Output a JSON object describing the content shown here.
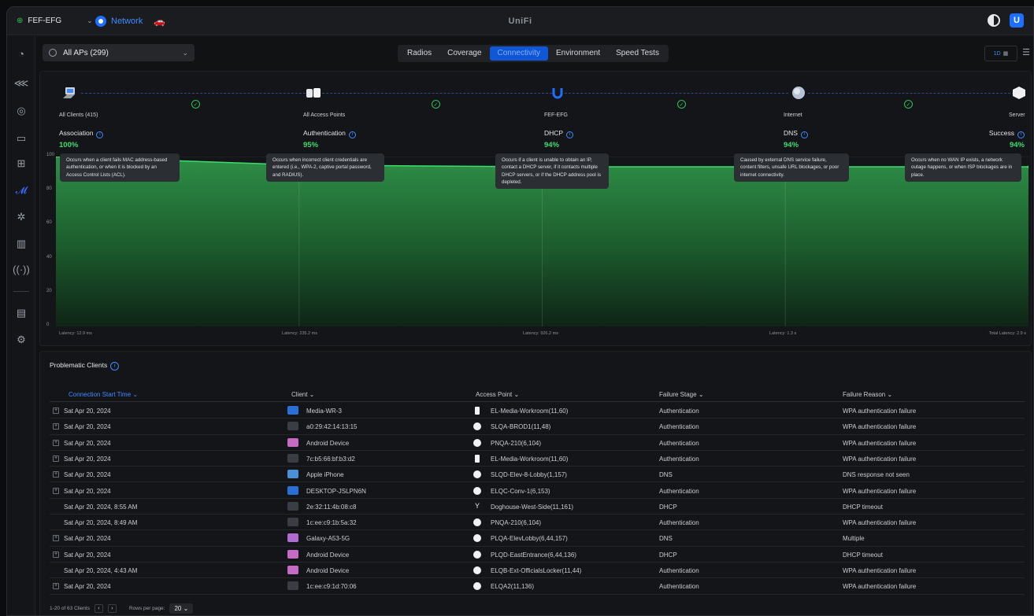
{
  "window": {
    "app_brand": "UniFi",
    "site": "FEF-EFG",
    "network_label": "Network",
    "user_initial": "U"
  },
  "toolbar": {
    "ap_filter": "All APs (299)",
    "tabs": [
      "Radios",
      "Coverage",
      "Connectivity",
      "Environment",
      "Speed Tests"
    ],
    "active_tab": "Connectivity",
    "range": "1D"
  },
  "flow": {
    "nodes": [
      "All Clients (415)",
      "All Access Points",
      "FEF-EFG",
      "Internet",
      "Server"
    ],
    "stats": [
      {
        "label": "Association",
        "value": "100%"
      },
      {
        "label": "Authentication",
        "value": "95%"
      },
      {
        "label": "DHCP",
        "value": "94%"
      },
      {
        "label": "DNS",
        "value": "94%"
      },
      {
        "label": "Success",
        "value": "94%"
      }
    ],
    "tooltips": [
      "Occurs when a client fails MAC address-based authentication, or when it is blocked by an Access Control Lists (ACL).",
      "Occurs when incorrect client credentials are entered (i.e., WPA-2, captive portal password, and RADIUS).",
      "Occurs if a client is unable to obtain an IP, contact a DHCP server, if it contacts multiple DHCP servers, or if the DHCP address pool is depleted.",
      "Caused by external DNS service failure, content filters, unsafe URL blockages, or poor internet connectivity.",
      "Occurs when no WAN IP exists, a network outage happens, or when ISP blockages are in place."
    ],
    "latencies": [
      "Latency: 12.9 ms",
      "Latency: 235.2 ms",
      "Latency: 926.2 ms",
      "Latency: 1.3 s",
      "Total Latency: 2.9 s"
    ]
  },
  "chart_data": {
    "type": "area",
    "x": [
      "Association",
      "Authentication",
      "DHCP",
      "DNS",
      "Success"
    ],
    "series": [
      {
        "values": [
          100,
          95,
          94,
          94,
          94
        ]
      }
    ],
    "ylim": [
      0,
      100
    ],
    "yticks": [
      "100",
      "80",
      "60",
      "40",
      "20",
      "0"
    ],
    "grid": true
  },
  "problematic": {
    "title": "Problematic Clients",
    "columns": [
      "Connection Start Time",
      "Client",
      "Access Point",
      "Failure Stage",
      "Failure Reason"
    ],
    "rows": [
      {
        "expand": true,
        "time": "Sat Apr 20, 2024",
        "client": "Media-WR-3",
        "ap": "EL-Media-Workroom(11,60)",
        "stage": "Authentication",
        "reason": "WPA authentication failure",
        "dev": "#2a6fd6",
        "apshape": "rect"
      },
      {
        "expand": true,
        "time": "Sat Apr 20, 2024",
        "client": "a0:29:42:14:13:15",
        "ap": "SLQA-BROD1(11,48)",
        "stage": "Authentication",
        "reason": "WPA authentication failure",
        "dev": "#3a3d44",
        "apshape": "dot"
      },
      {
        "expand": true,
        "time": "Sat Apr 20, 2024",
        "client": "Android Device",
        "ap": "PNQA-210(6,104)",
        "stage": "Authentication",
        "reason": "WPA authentication failure",
        "dev": "#c56bc4",
        "apshape": "dot"
      },
      {
        "expand": true,
        "time": "Sat Apr 20, 2024",
        "client": "7c:b5:66:bf:b3:d2",
        "ap": "EL-Media-Workroom(11,60)",
        "stage": "Authentication",
        "reason": "WPA authentication failure",
        "dev": "#3a3d44",
        "apshape": "rect"
      },
      {
        "expand": true,
        "time": "Sat Apr 20, 2024",
        "client": "Apple iPhone",
        "ap": "SLQD-Elev-8-Lobby(1,157)",
        "stage": "DNS",
        "reason": "DNS response not seen",
        "dev": "#4a8fd8",
        "apshape": "dot"
      },
      {
        "expand": true,
        "time": "Sat Apr 20, 2024",
        "client": "DESKTOP-JSLPN6N",
        "ap": "ELQC-Conv-1(6,153)",
        "stage": "Authentication",
        "reason": "WPA authentication failure",
        "dev": "#2a6fd6",
        "apshape": "dot"
      },
      {
        "expand": false,
        "time": "Sat Apr 20, 2024, 8:55 AM",
        "client": "2e:32:11:4b:08:c8",
        "ap": "Doghouse-West-Side(11,161)",
        "stage": "DHCP",
        "reason": "DHCP timeout",
        "dev": "#3a3d44",
        "apshape": "ant"
      },
      {
        "expand": false,
        "time": "Sat Apr 20, 2024, 8:49 AM",
        "client": "1c:ee:c9:1b:5a:32",
        "ap": "PNQA-210(6,104)",
        "stage": "Authentication",
        "reason": "WPA authentication failure",
        "dev": "#3a3d44",
        "apshape": "dot"
      },
      {
        "expand": true,
        "time": "Sat Apr 20, 2024",
        "client": "Galaxy-A53-5G",
        "ap": "PLQA-ElevLobby(6,44,157)",
        "stage": "DNS",
        "reason": "Multiple",
        "dev": "#b06bd0",
        "apshape": "dot"
      },
      {
        "expand": true,
        "time": "Sat Apr 20, 2024",
        "client": "Android Device",
        "ap": "PLQD-EastEntrance(6,44,136)",
        "stage": "DHCP",
        "reason": "DHCP timeout",
        "dev": "#c56bc4",
        "apshape": "dot"
      },
      {
        "expand": false,
        "time": "Sat Apr 20, 2024, 4:43 AM",
        "client": "Android Device",
        "ap": "ELQB-Ext-OfficialsLocker(11,44)",
        "stage": "Authentication",
        "reason": "WPA authentication failure",
        "dev": "#c56bc4",
        "apshape": "dot"
      },
      {
        "expand": true,
        "time": "Sat Apr 20, 2024",
        "client": "1c:ee:c9:1d:70:06",
        "ap": "ELQA2(11,136)",
        "stage": "Authentication",
        "reason": "WPA authentication failure",
        "dev": "#3a3d44",
        "apshape": "dot"
      }
    ],
    "pager": {
      "summary": "1-20 of 63 Clients",
      "rows_label": "Rows per page:",
      "rows_value": "20"
    }
  },
  "colors": {
    "accent": "#3d8bff",
    "success": "#3ddc6e",
    "area": "#1f6b35"
  }
}
